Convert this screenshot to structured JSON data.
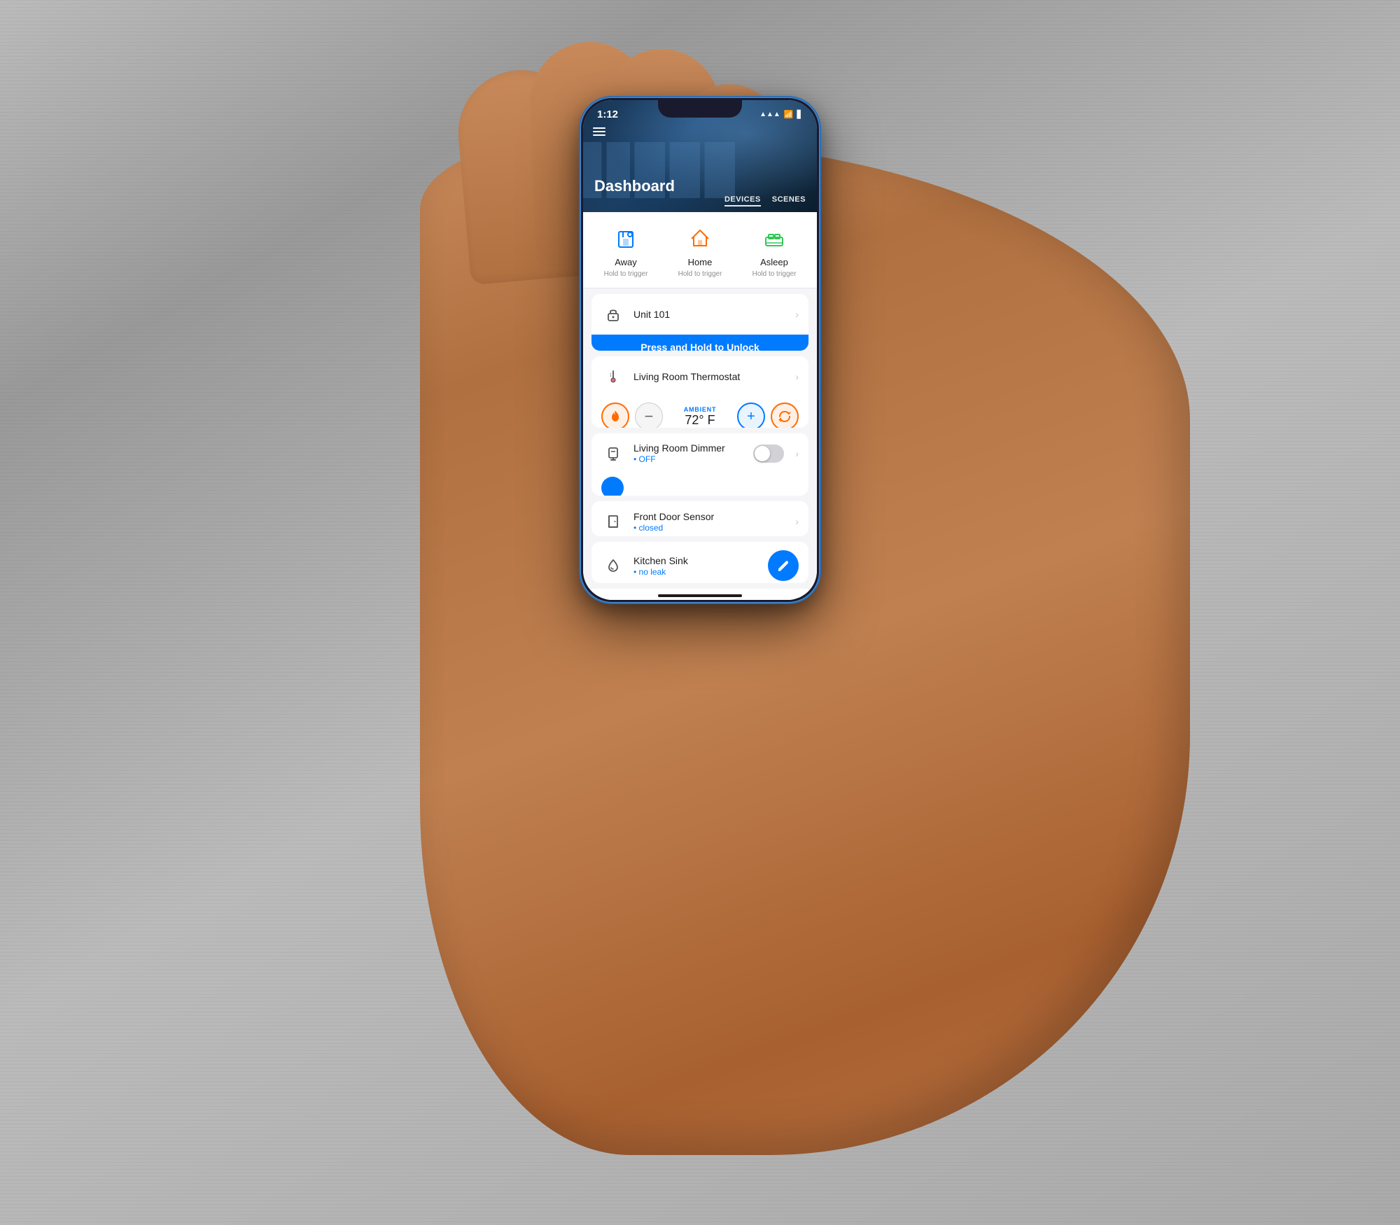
{
  "phone": {
    "status_bar": {
      "time": "1:12",
      "signal": "●●●●",
      "wifi": "wifi",
      "battery": "battery"
    },
    "nav": {
      "menu_icon": "≡",
      "items": [
        {
          "label": "DEVICES",
          "active": true
        },
        {
          "label": "SCENES",
          "active": false
        }
      ]
    },
    "hero": {
      "title": "Dashboard"
    },
    "scenes": [
      {
        "id": "away",
        "icon": "🚪",
        "label": "Away",
        "sublabel": "Hold to trigger"
      },
      {
        "id": "home",
        "icon": "🏠",
        "label": "Home",
        "sublabel": "Hold to trigger"
      },
      {
        "id": "asleep",
        "icon": "🛏",
        "label": "Asleep",
        "sublabel": "Hold to trigger"
      }
    ],
    "devices": [
      {
        "id": "lock",
        "name": "Unit 101",
        "type": "lock",
        "has_action": true,
        "action_label": "Press and Hold to Unlock"
      },
      {
        "id": "thermostat",
        "name": "Living Room Thermostat",
        "type": "thermostat",
        "ambient_label": "AMBIENT",
        "temp": "72° F",
        "has_controls": true
      },
      {
        "id": "dimmer",
        "name": "Living Room Dimmer",
        "status": "• OFF",
        "type": "dimmer",
        "has_toggle": true,
        "toggle_on": false
      },
      {
        "id": "door",
        "name": "Front Door Sensor",
        "status": "• closed",
        "type": "door"
      },
      {
        "id": "water",
        "name": "Kitchen Sink",
        "status": "• no leak",
        "type": "water",
        "has_fab": true
      }
    ]
  }
}
